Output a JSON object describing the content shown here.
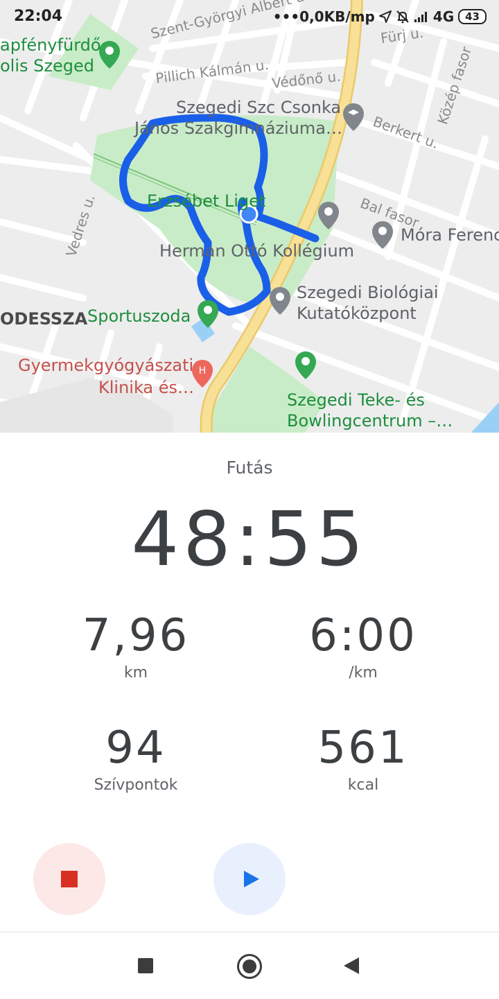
{
  "status_bar": {
    "time": "22:04",
    "network_speed": "•••0,0KB/mp",
    "network_type": "4G",
    "battery": "43",
    "icons": [
      "location-arrow-icon",
      "bell-off-icon",
      "signal-icon"
    ]
  },
  "map": {
    "streets": [
      "Szent-Györgyi Albert u.",
      "Fürj u.",
      "Pillich Kálmán u.",
      "Védőnő u.",
      "Berkert u.",
      "Közép fasor",
      "Bal fasor",
      "Vedres u."
    ],
    "places": {
      "fenyfurdo_1": "apfényfürdő",
      "fenyfurdo_2": "olis Szeged",
      "szc_1": "Szegedi Szc Csonka",
      "szc_2": "János Szakgimnáziuma…",
      "liget": "Erzsébet Liget",
      "mora": "Móra Ferenc",
      "herman": "Herman Ottó Kollégium",
      "biologiai_1": "Szegedi Biológiai",
      "biologiai_2": "Kutatóközpont",
      "odessza": "ODESSZA",
      "sportuszoda": "Sportuszoda",
      "klinika_1": "Gyermekgyógyászati",
      "klinika_2": "Klinika és…",
      "teke_1": "Szegedi Teke- és",
      "teke_2": "Bowlingcentrum –…"
    },
    "colors": {
      "route": "#1a5fe8",
      "park": "#c9ecc8",
      "main_road": "#f8e196",
      "current_location": "#4285f4"
    }
  },
  "workout": {
    "activity": "Futás",
    "elapsed": "48:55",
    "distance": {
      "value": "7,96",
      "unit": "km"
    },
    "pace": {
      "value": "6:00",
      "unit": "/km"
    },
    "heart_points": {
      "value": "94",
      "unit": "Szívpontok"
    },
    "calories": {
      "value": "561",
      "unit": "kcal"
    }
  },
  "controls": {
    "stop_icon": "stop-icon",
    "play_icon": "play-icon"
  },
  "nav": {
    "icons": [
      "recent-apps-icon",
      "home-icon",
      "back-icon"
    ]
  }
}
